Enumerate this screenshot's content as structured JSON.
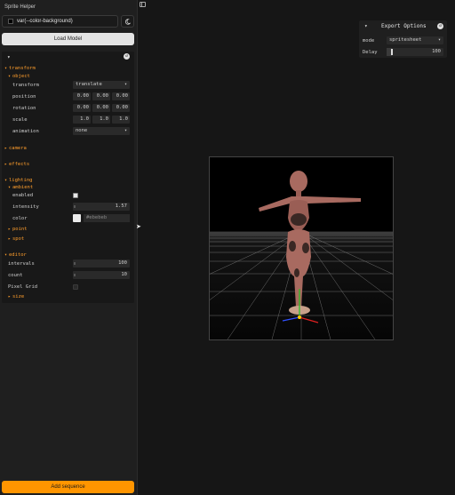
{
  "app": {
    "title": "Sprite Helper"
  },
  "background": {
    "value": "var(--color-background)"
  },
  "buttons": {
    "load_model": "Load Model",
    "add_sequence": "Add sequence"
  },
  "panel": {
    "transform": {
      "label": "transform",
      "object_label": "object",
      "transform_label": "transform",
      "transform_value": "translate",
      "position_label": "position",
      "position": [
        "0.00",
        "0.00",
        "0.00"
      ],
      "rotation_label": "rotation",
      "rotation": [
        "0.00",
        "0.00",
        "0.00"
      ],
      "scale_label": "scale",
      "scale": [
        "1.0",
        "1.0",
        "1.0"
      ],
      "animation_label": "animation",
      "animation_value": "none"
    },
    "camera_label": "camera",
    "effects_label": "effects",
    "lighting": {
      "label": "lighting",
      "ambient_label": "ambient",
      "enabled_label": "enabled",
      "intensity_label": "intensity",
      "intensity_value": "1.57",
      "intensity_fraction": 0.52,
      "color_label": "color",
      "color_value": "#ebebeb",
      "point_label": "point",
      "spot_label": "spot"
    },
    "editor": {
      "label": "editor",
      "intervals_label": "intervals",
      "intervals_value": "100",
      "count_label": "count",
      "count_value": "10",
      "pixel_grid_label": "Pixel Grid",
      "pixel_grid_checked": false,
      "size_label": "size"
    }
  },
  "export": {
    "title": "Export Options",
    "mode_label": "mode",
    "mode_value": "spritesheet",
    "delay_label": "Delay",
    "delay_value": "100",
    "delay_fraction": 0.1
  },
  "colors": {
    "accent": "#ff9500",
    "section": "#ff9e2c",
    "ambient_color": "#ebebeb"
  }
}
